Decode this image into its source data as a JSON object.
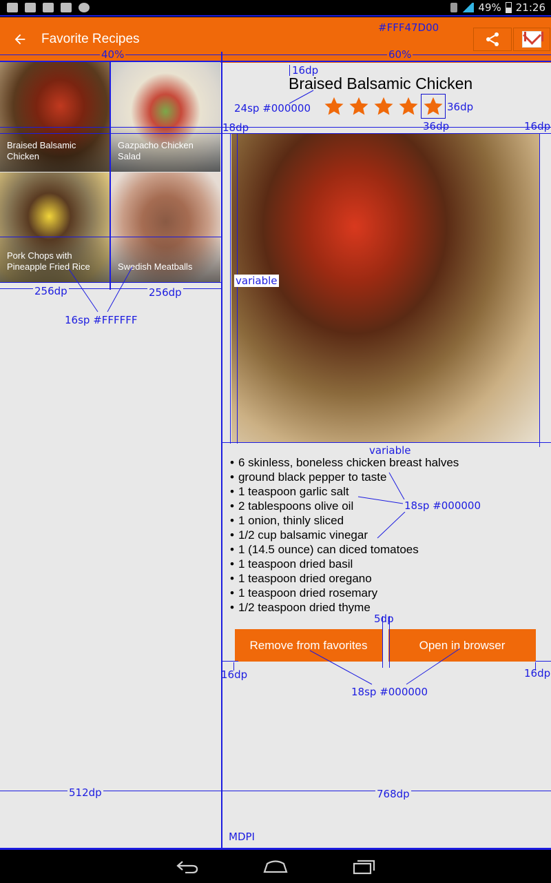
{
  "status_bar": {
    "battery": "49%",
    "time": "21:26"
  },
  "app_bar": {
    "title": "Favorite Recipes",
    "back_icon": "arrow-back-icon",
    "share_icon": "share-icon",
    "gmail_icon": "gmail-icon"
  },
  "recipes": [
    {
      "name": "Braised Balsamic Chicken"
    },
    {
      "name": "Gazpacho Chicken Salad"
    },
    {
      "name": "Pork Chops with Pineapple Fried Rice"
    },
    {
      "name": "Swedish Meatballs"
    }
  ],
  "detail": {
    "title": "Braised Balsamic Chicken",
    "rating": 5,
    "rating_max": 5,
    "ingredients": [
      "6 skinless, boneless chicken breast halves",
      "ground black pepper to taste",
      "1 teaspoon garlic salt",
      "2 tablespoons olive oil",
      "1 onion, thinly sliced",
      "1/2 cup balsamic vinegar",
      "1 (14.5 ounce) can diced tomatoes",
      "1 teaspoon dried basil",
      "1 teaspoon dried oregano",
      "1 teaspoon dried rosemary",
      "1/2 teaspoon dried thyme"
    ],
    "remove_label": "Remove from favorites",
    "open_label": "Open in browser"
  },
  "annotations": {
    "color_app_bar": "#FFF47D00",
    "pct_left": "40%",
    "pct_right": "60%",
    "title_pad": "16dp",
    "title_font": "24sp #000000",
    "star_size_h": "36dp",
    "star_size_w": "36dp",
    "img_margin_left": "18dp",
    "img_margin_right": "16dp",
    "img_height": "variable",
    "img_width": "variable",
    "tile_w1": "256dp",
    "tile_w2": "256dp",
    "tile_font": "16sp #FFFFFF",
    "list_font": "18sp #000000",
    "btn_gap": "5dp",
    "btn_margin_left": "16dp",
    "btn_margin_right": "16dp",
    "btn_font": "18sp #000000",
    "left_width": "512dp",
    "right_width": "768dp",
    "density": "MDPI"
  },
  "colors": {
    "accent": "#f0690a",
    "redline": "#1c1ce0",
    "star": "#f0690a"
  }
}
